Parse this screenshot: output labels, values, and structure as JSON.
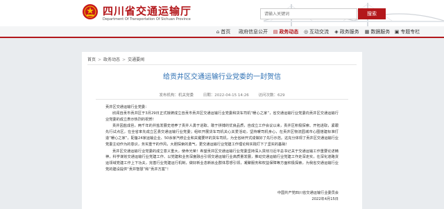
{
  "header": {
    "site_title": "四川省交通运输厅",
    "site_subtitle": "Department Of Transportation Of Sichuan Province",
    "search_placeholder": "请输入关键词",
    "search_button": "搜索"
  },
  "nav": {
    "items": [
      {
        "icon": "home-icon",
        "label": "首页",
        "active": false
      },
      {
        "icon": "info-icon",
        "label": "政府信息公开",
        "active": false
      },
      {
        "icon": "news-icon",
        "label": "政务动态",
        "active": true
      },
      {
        "icon": "chat-icon",
        "label": "互动交流",
        "active": false
      },
      {
        "icon": "service-icon",
        "label": "政务服务",
        "active": false
      },
      {
        "icon": "grid-icon",
        "label": "数据服务",
        "active": false
      },
      {
        "icon": "topic-icon",
        "label": "专题专栏",
        "active": false
      }
    ]
  },
  "breadcrumb": [
    "首页",
    "政务动态",
    "交通要闻"
  ],
  "article": {
    "title": "给贡井区交通运输行业党委的一封贺信",
    "source": "发布机构：机关党委",
    "date": "日期：2022-04-15 14:26",
    "views": "访问次数：629",
    "greeting": "贡井区交通运输行业党委：",
    "paragraphs": [
      "欣闻自贡市贡井区于3月29日正式授牌成立自贡市贡井区交通运输行业党委和货车司机“暖心之家”，省交通运输行业党委向贡井区交通运输行业党委的成立表示热烈的祝贺！",
      "贡井因盐成邑，两千年的井盐发展史培养了贡井人勇于进取、敢于拼搏的优良品质，自成立工作会议以来，贡井区积极探索、开拓进取，紧跟先行试点区，在全省率先成立区县交通运输行业党委；组织开展货车司机关心关爱活动，坚持暖司机身心，在贡井区物流园城市心圈搭建标准打造“暖心之家”，配备24家运输企业、50余家汽修企业和关键要环的货车司机，为全省树开式成做好了先行示范。这充分体现了贡井区交通运输行业党委主动作为的意识，务实重干的作风，大胆探索的勇气，更交通运输行业党建工作理论和实践打下了坚实的基础！",
      "贡井区交通运输行业党委的成立意义重大，使命光荣！希望贡井区交通运输行业党委坚持深入贯彻习近平总书记关于交通运输工作重要论述精神，科学谋划交通运输行业党建工作、以党建和业务深度融合引领交通运输行业高质量发展，推动交通运输行业党建工作走深走实，在深化道路货运领域党建工作上下功夫，完善行业党建运行机制，做好新业态新就业群体思想引领，凝聚服务和权益保障等方面积极探索，为我省交通运输行业党的建设提供“贡井智慧”和“贡井方案”！"
    ],
    "signature": "中国共产党四川省交通运输行业委员会",
    "sign_date": "2022年4月15日"
  }
}
